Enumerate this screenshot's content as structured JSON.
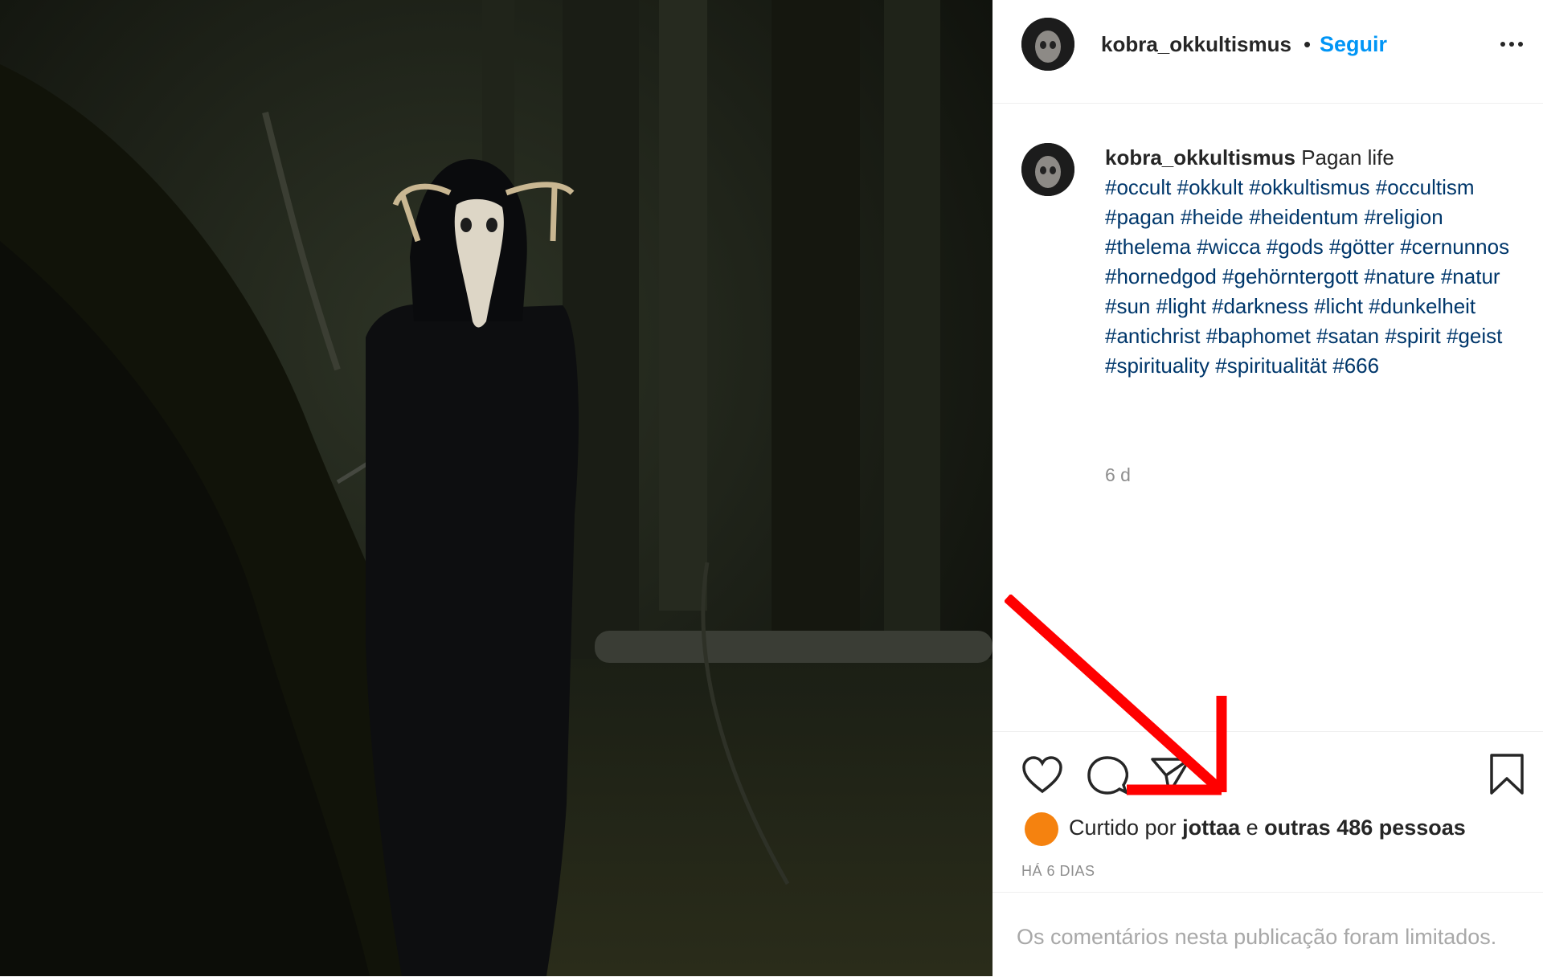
{
  "post": {
    "username": "kobra_okkultismus",
    "separator": "•",
    "follow_label": "Seguir",
    "more_icon": "more-options-icon",
    "caption_text": "Pagan life",
    "hashtags": [
      "#occult",
      "#okkult",
      "#okkultismus",
      "#occultism",
      "#pagan",
      "#heide",
      "#heidentum",
      "#religion",
      "#thelema",
      "#wicca",
      "#gods",
      "#götter",
      "#cernunnos",
      "#hornedgod",
      "#gehörntergott",
      "#nature",
      "#natur",
      "#sun",
      "#light",
      "#darkness",
      "#licht",
      "#dunkelheit",
      "#antichrist",
      "#baphomet",
      "#satan",
      "#spirit",
      "#geist",
      "#spirituality",
      "#spiritualität",
      "#666"
    ],
    "caption_time": "6 d"
  },
  "likes": {
    "prefix": "Curtido por",
    "user": "jottaa",
    "conjunction": "e",
    "others": "outras 486 pessoas"
  },
  "date_label": "HÁ 6 DIAS",
  "comments_limited": "Os comentários nesta publicação foram limitados.",
  "colors": {
    "follow": "#0095f6",
    "hashtag": "#00376b",
    "annotation_arrow": "#ff0000",
    "liker_avatar": "#f5820f"
  }
}
